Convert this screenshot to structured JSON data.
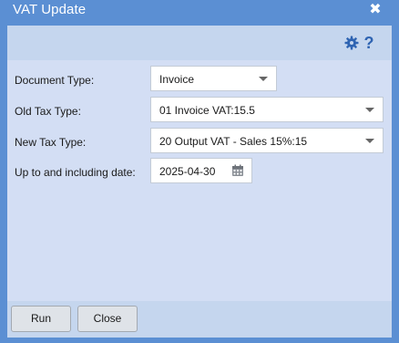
{
  "window": {
    "title": "VAT Update",
    "close_glyph": "✖"
  },
  "toolbar": {
    "settings_icon": "gear-icon",
    "help_label": "?"
  },
  "form": {
    "document_type": {
      "label": "Document Type:",
      "value": "Invoice"
    },
    "old_tax_type": {
      "label": "Old Tax Type:",
      "value": "01 Invoice VAT:15.5"
    },
    "new_tax_type": {
      "label": "New Tax Type:",
      "value": "20 Output VAT - Sales 15%:15"
    },
    "up_to_date": {
      "label": "Up to and including date:",
      "value": "2025-04-30"
    }
  },
  "buttons": {
    "run_label": "Run",
    "close_label": "Close"
  },
  "colors": {
    "titlebar": "#5b8fd3",
    "panel": "#d3def4",
    "bar": "#c5d6ee",
    "icon_accent": "#2f64b2"
  }
}
